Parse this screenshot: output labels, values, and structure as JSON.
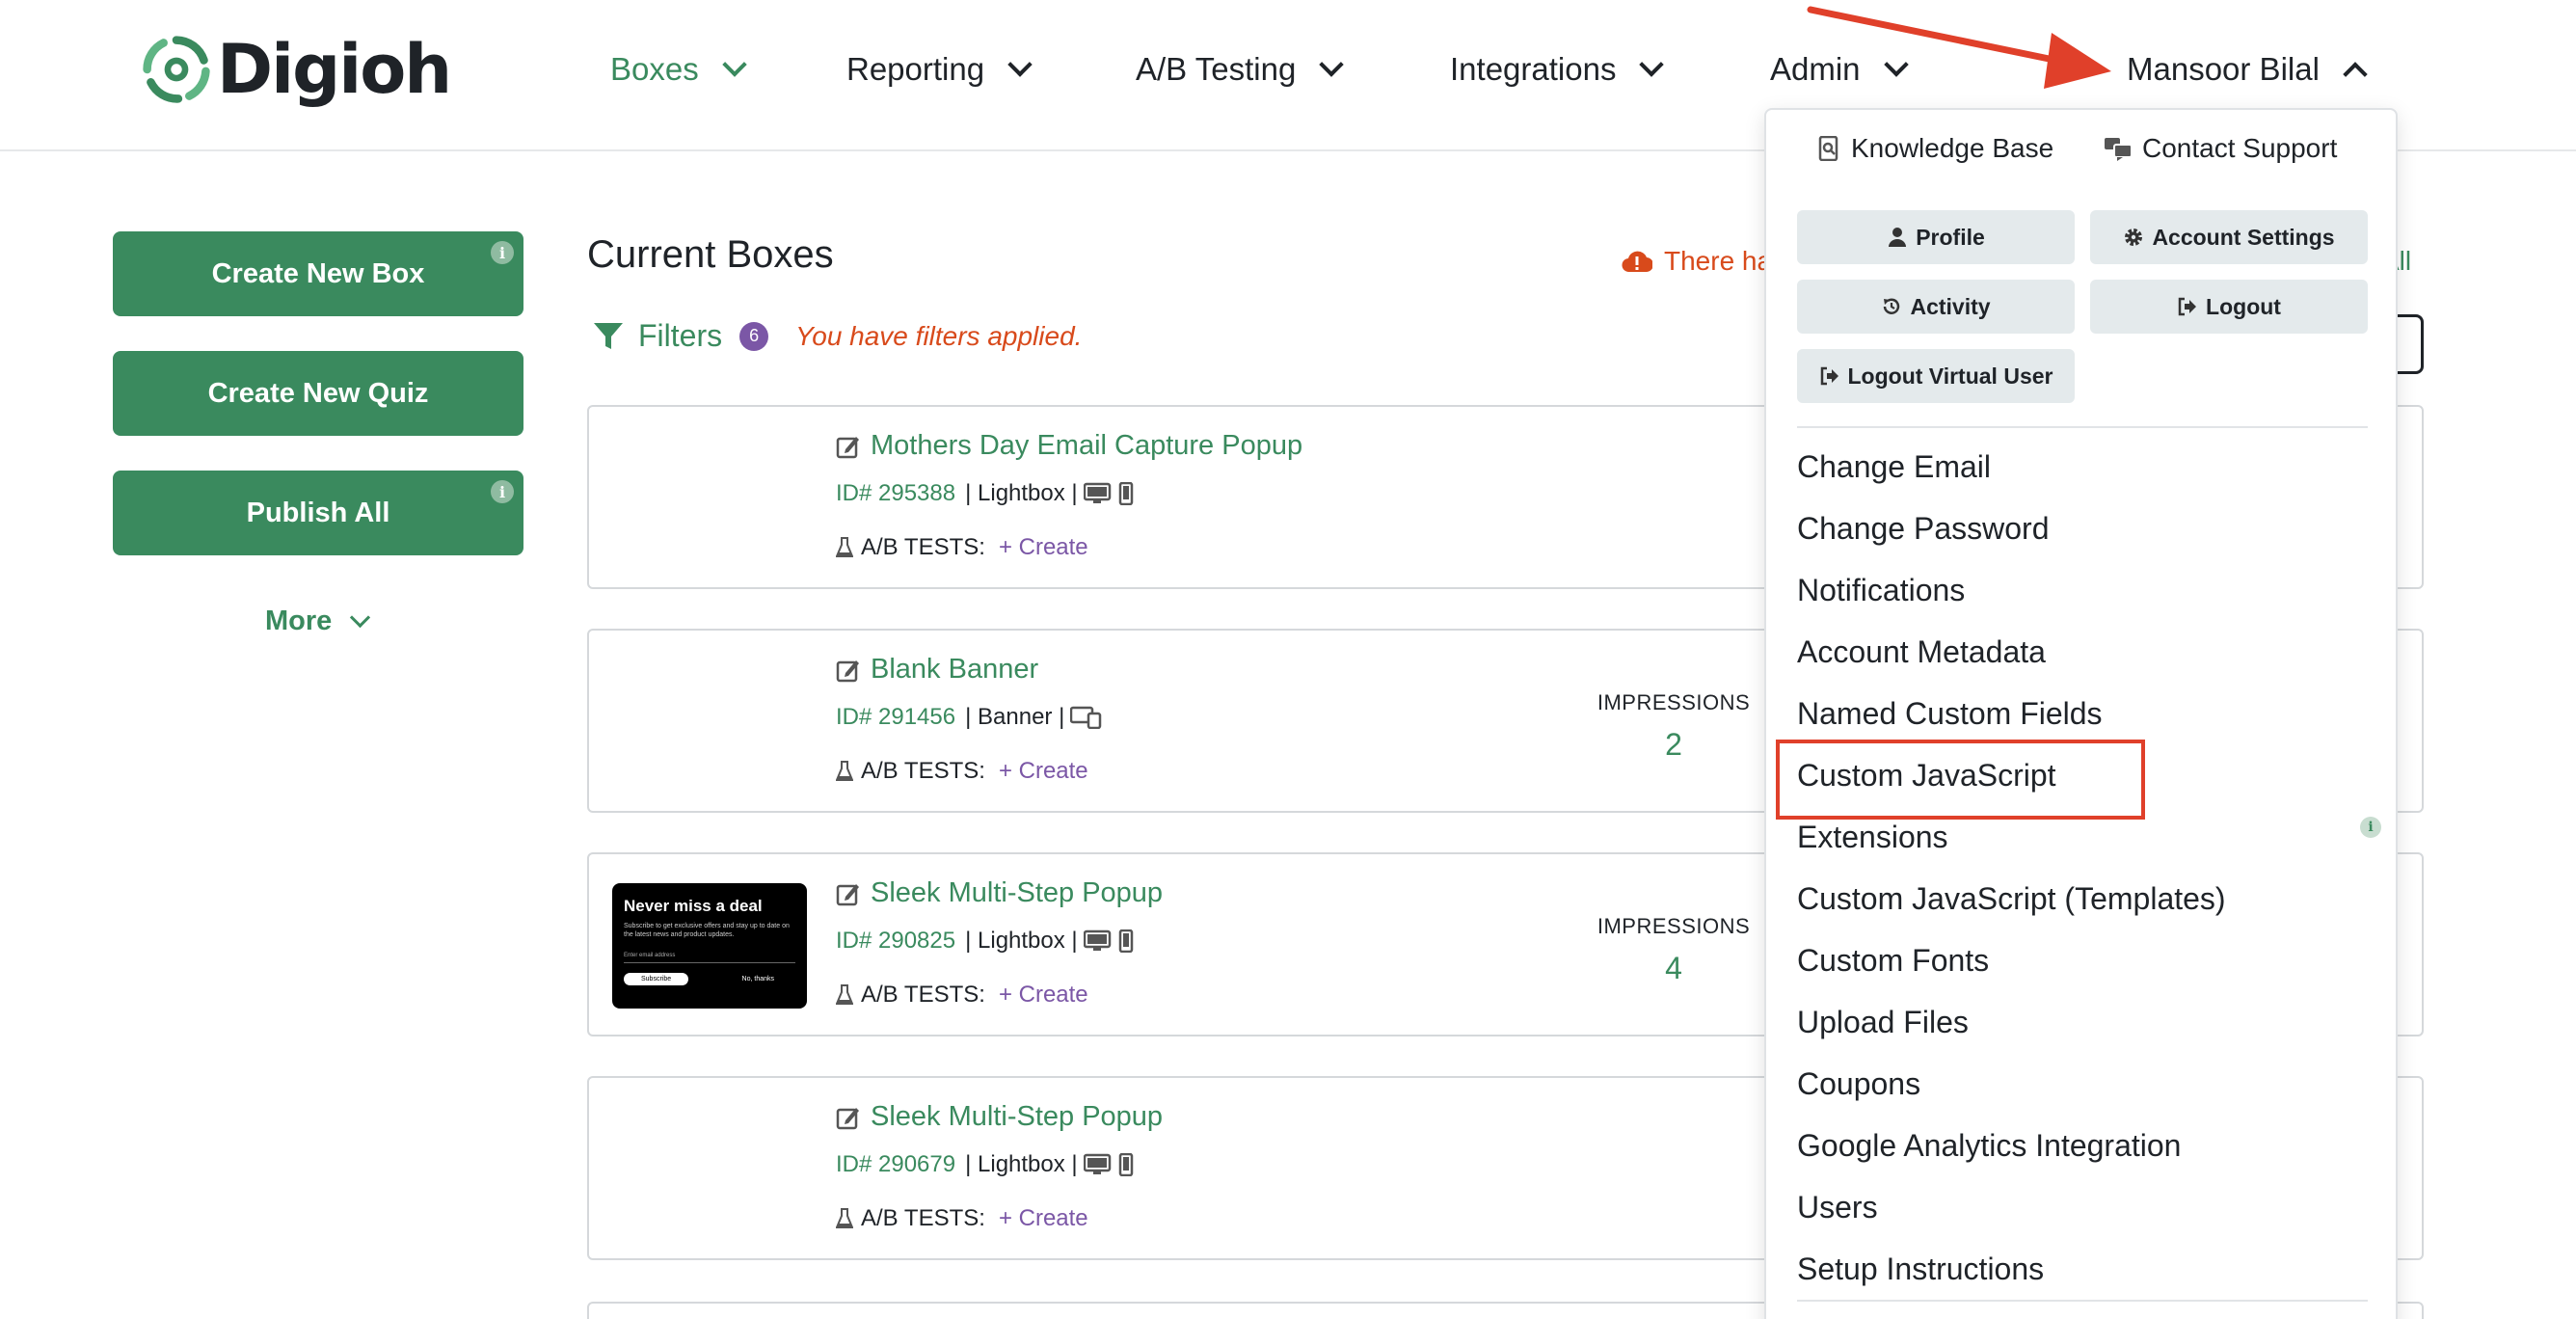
{
  "brand": {
    "logo_text": "Digioh",
    "accent": "#3a8a5e",
    "warning_color": "#d84a1b",
    "purple": "#7b57a6"
  },
  "nav": {
    "items": [
      {
        "label": "Boxes",
        "active": true
      },
      {
        "label": "Reporting"
      },
      {
        "label": "A/B Testing"
      },
      {
        "label": "Integrations"
      },
      {
        "label": "Admin"
      }
    ],
    "user": {
      "label": "Mansoor Bilal",
      "expanded": true
    }
  },
  "sidebar": {
    "create_box": "Create New Box",
    "create_quiz": "Create New Quiz",
    "publish_all": "Publish All",
    "more": "More",
    "info_glyph": "i"
  },
  "main": {
    "title": "Current Boxes",
    "warning": "There ha",
    "right_link": "All",
    "filters": {
      "label": "Filters",
      "count": "6",
      "note": "You have filters applied."
    }
  },
  "boxes": [
    {
      "name": "Mothers Day Email Capture Popup",
      "id": "ID# 295388",
      "type": "Lightbox",
      "devices": "desktop-mobile",
      "ab_label": "A/B TESTS:",
      "ab_create": "+ Create",
      "impressions_label": "",
      "impressions": "",
      "thumbnail": false
    },
    {
      "name": "Blank Banner",
      "id": "ID# 291456",
      "type": "Banner",
      "devices": "all-devices",
      "ab_label": "A/B TESTS:",
      "ab_create": "+ Create",
      "impressions_label": "IMPRESSIONS",
      "impressions": "2",
      "thumbnail": false
    },
    {
      "name": "Sleek Multi-Step Popup",
      "id": "ID# 290825",
      "type": "Lightbox",
      "devices": "desktop-mobile",
      "ab_label": "A/B TESTS:",
      "ab_create": "+ Create",
      "impressions_label": "IMPRESSIONS",
      "impressions": "4",
      "thumbnail": true,
      "thumb": {
        "headline": "Never miss a deal",
        "body": "Subscribe to get exclusive offers and stay up to date on the latest news and product updates.",
        "field": "Enter email address",
        "button": "Subscribe",
        "decline": "No, thanks"
      }
    },
    {
      "name": "Sleek Multi-Step Popup",
      "id": "ID# 290679",
      "type": "Lightbox",
      "devices": "desktop-mobile",
      "ab_label": "A/B TESTS:",
      "ab_create": "+ Create",
      "impressions_label": "",
      "impressions": "",
      "thumbnail": false
    }
  ],
  "dropdown": {
    "knowledge_base": "Knowledge Base",
    "contact_support": "Contact Support",
    "profile": "Profile",
    "account_settings": "Account Settings",
    "activity": "Activity",
    "logout": "Logout",
    "logout_virtual": "Logout Virtual User",
    "items": [
      "Change Email",
      "Change Password",
      "Notifications",
      "Account Metadata",
      "Named Custom Fields",
      "Custom JavaScript",
      "Extensions",
      "Custom JavaScript (Templates)",
      "Custom Fonts",
      "Upload Files",
      "Coupons",
      "Google Analytics Integration",
      "Users",
      "Setup Instructions"
    ],
    "highlighted": "Custom JavaScript"
  }
}
